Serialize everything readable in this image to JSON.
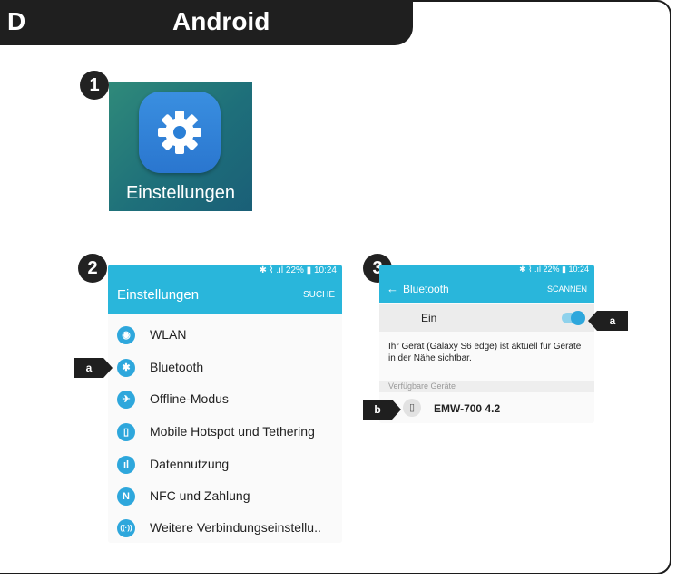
{
  "header": {
    "letter": "D",
    "title": "Android"
  },
  "steps": [
    "1",
    "2",
    "3"
  ],
  "tags": {
    "a": "a",
    "b": "b"
  },
  "screen1": {
    "label": "Einstellungen",
    "icon": "gear-icon"
  },
  "screen2": {
    "status": "✱ ⌇ .ıl 22% ▮ 10:24",
    "title": "Einstellungen",
    "action": "SUCHE",
    "items": [
      {
        "label": "WLAN",
        "icon": "wifi-icon",
        "glyph": "◉"
      },
      {
        "label": "Bluetooth",
        "icon": "bluetooth-icon",
        "glyph": "✱"
      },
      {
        "label": "Offline-Modus",
        "icon": "airplane-icon",
        "glyph": "✈"
      },
      {
        "label": "Mobile Hotspot und Tethering",
        "icon": "hotspot-icon",
        "glyph": "▯"
      },
      {
        "label": "Datennutzung",
        "icon": "data-usage-icon",
        "glyph": "ıl"
      },
      {
        "label": "NFC und Zahlung",
        "icon": "nfc-icon",
        "glyph": "N"
      },
      {
        "label": "Weitere Verbindungseinstellu..",
        "icon": "more-connections-icon",
        "glyph": "((·))"
      }
    ]
  },
  "screen3": {
    "status": "✱ ⌇ .ıl 22% ▮ 10:24",
    "back": "←",
    "title": "Bluetooth",
    "action": "SCANNEN",
    "toggle_label": "Ein",
    "toggle_state": "on",
    "info": "Ihr Gerät (Galaxy S6 edge) ist aktuell für Geräte in der Nähe sichtbar.",
    "section": "Verfügbare Geräte",
    "device": {
      "name": "EMW-700 4.2",
      "icon": "mouse-icon",
      "glyph": "▯"
    }
  },
  "colors": {
    "accent": "#29b6db",
    "dark": "#1f1f1f"
  }
}
